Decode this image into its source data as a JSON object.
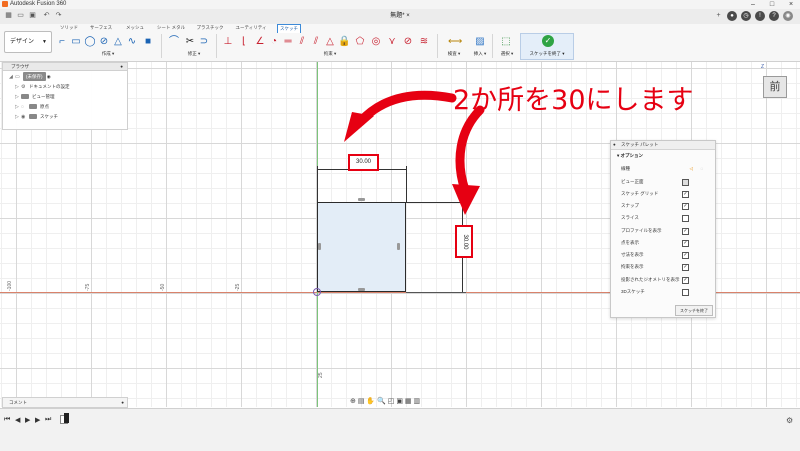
{
  "window": {
    "title": "Autodesk Fusion 360",
    "doc_tab": "無題*"
  },
  "ribbon": {
    "workspace": "デザイン",
    "tabs": [
      "ソリッド",
      "サーフェス",
      "メッシュ",
      "シート メタル",
      "プラスチック",
      "ユーティリティ",
      "スケッチ"
    ],
    "active_tab": "スケッチ",
    "groups": {
      "create": "作成",
      "modify": "修正",
      "constraints": "拘束",
      "inspect": "検査",
      "insert": "挿入",
      "select": "選択"
    },
    "finish_sketch": "スケッチを終了"
  },
  "browser": {
    "title": "ブラウザ",
    "root": "(未保存)",
    "nodes": [
      "ドキュメントの設定",
      "ビュー管理",
      "原点",
      "スケッチ"
    ]
  },
  "annotation": "2か所を30にします",
  "dimensions": {
    "top": "30.00",
    "right": "30.00"
  },
  "axis_labels": {
    "m100": "-100",
    "m75": "-75",
    "m50": "-50",
    "m25": "-25",
    "y25": "25"
  },
  "viewcube": {
    "face": "前",
    "axis": "Z"
  },
  "palette": {
    "title": "スケッチ パレット",
    "section": "オプション",
    "rows": [
      {
        "label": "線種",
        "checked": null
      },
      {
        "label": "ビュー正面",
        "checked": null
      },
      {
        "label": "スケッチ グリッド",
        "checked": true
      },
      {
        "label": "スナップ",
        "checked": true
      },
      {
        "label": "スライス",
        "checked": false
      },
      {
        "label": "プロファイルを表示",
        "checked": true
      },
      {
        "label": "点を表示",
        "checked": true
      },
      {
        "label": "寸法を表示",
        "checked": true
      },
      {
        "label": "拘束を表示",
        "checked": true
      },
      {
        "label": "投影されたジオメトリを表示",
        "checked": true
      },
      {
        "label": "3Dスケッチ",
        "checked": false
      }
    ],
    "finish": "スケッチを終了"
  },
  "comments": "コメント"
}
